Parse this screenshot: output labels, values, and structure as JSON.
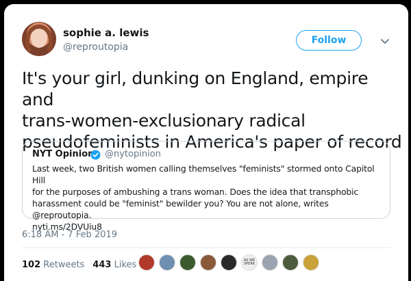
{
  "user": {
    "name": "sophie a. lewis",
    "handle": "@reproutopia",
    "follow_label": "Follow"
  },
  "tweet": {
    "line1": "It's your girl, dunking on England, empire and",
    "line2": "trans-women-exclusionary radical",
    "line3": "pseudofeminists in America's paper of record"
  },
  "quote": {
    "name": "NYT Opinion",
    "handle": "@nytopinion",
    "line1": "Last week, two British women calling themselves \"feminists\" stormed onto Capitol Hill",
    "line2": "for the purposes of ambushing a trans woman. Does the idea that transphobic",
    "line3": "harassment could be \"feminist\" bewilder you? You are not alone, writes @reproutopia.",
    "line4": "nyti.ms/2DVUiu8"
  },
  "timestamp": "6:18 AM - 7 Feb 2019",
  "stats": {
    "retweets_count": "102",
    "retweets_label": "Retweets",
    "likes_count": "443",
    "likes_label": "Likes"
  },
  "likers": [
    {
      "name": "liker-1",
      "color": "#b23a2a"
    },
    {
      "name": "liker-2",
      "color": "#6f8fb0"
    },
    {
      "name": "liker-3",
      "color": "#3b5a2e"
    },
    {
      "name": "liker-4",
      "color": "#8a5a3a"
    },
    {
      "name": "liker-5",
      "color": "#2a2a2a"
    },
    {
      "name": "liker-6",
      "color": "#eeeeee",
      "tag": "AS WE SPEAK"
    },
    {
      "name": "liker-7",
      "color": "#9aa4b0"
    },
    {
      "name": "liker-8",
      "color": "#4d5b3e"
    },
    {
      "name": "liker-9",
      "color": "#c9a23a"
    }
  ],
  "colors": {
    "accent": "#1da1f2",
    "secondary_text": "#657786",
    "primary_text": "#14171a"
  },
  "icons": [
    "chevron-down-icon",
    "verified-badge-icon"
  ]
}
